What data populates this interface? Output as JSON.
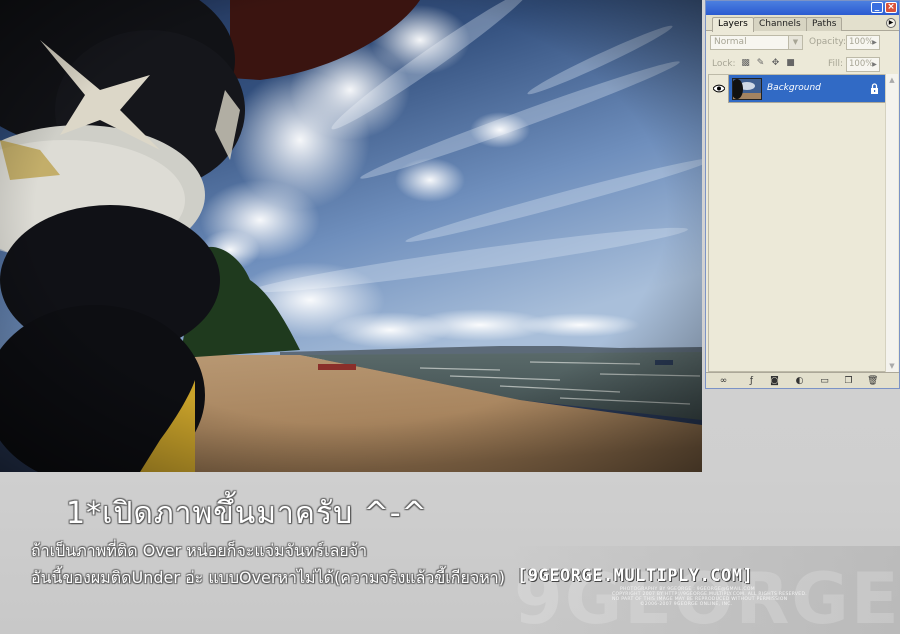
{
  "photo": {
    "alt": "beach photo with tires, sky and sea"
  },
  "panel": {
    "tabs": [
      {
        "label": "Layers",
        "active": true
      },
      {
        "label": "Channels",
        "active": false
      },
      {
        "label": "Paths",
        "active": false
      }
    ],
    "blend_mode": "Normal",
    "opacity_label": "Opacity:",
    "opacity_value": "100%",
    "lock_label": "Lock:",
    "fill_label": "Fill:",
    "fill_value": "100%",
    "layer_name": "Background",
    "selection_color": "#316ac5"
  },
  "captions": {
    "title": "1*เปิดภาพขึ้นมาครับ ^-^",
    "line1": "ถ้าเป็นภาพที่ติด Over หน่อยก็จะแจ่มจันทร์เลยจ้า",
    "line2": "อันนี้ของผมติดUnder อ่ะ แบบOverหาไม่ได้(ความจริงแล้วขี้เกียจหา)"
  },
  "watermark": {
    "title": "[9GEORGE.MULTIPLY.COM]",
    "big": "9GEORGE",
    "line1": "PHOTOGRAPHY BY 9GEORGE : 9GEORGE@GMAIL.COM",
    "line2": "COPYRIGHT 2007 BY HTTP://9GEORGE.MULTIPLY.COM. ALL RIGHTS RESERVED.",
    "line3": "NO PART OF THIS IMAGE MAY BE REPRODUCED WITHOUT PERMISSION",
    "line4": "©2006-2007 9GEORGE ONLINE, INC."
  }
}
